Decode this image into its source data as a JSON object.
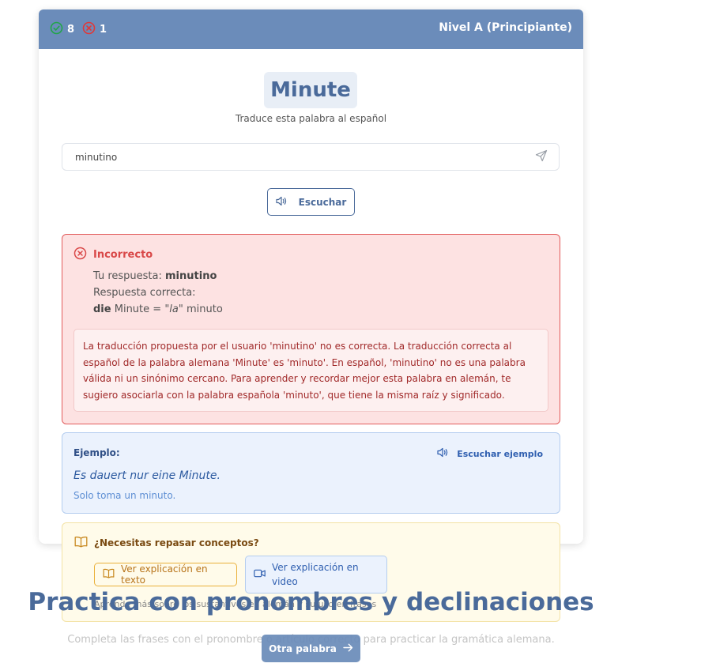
{
  "header": {
    "correct_count": "8",
    "incorrect_count": "1",
    "level": "Nivel A (Principiante)"
  },
  "word": {
    "german": "Minute",
    "instruction": "Traduce esta palabra al español"
  },
  "answer_input": {
    "value": "minutino"
  },
  "listen_button": {
    "label": "Escuchar"
  },
  "feedback": {
    "title": "Incorrecto",
    "your_answer_label": "Tu respuesta:",
    "your_answer": "minutino",
    "correct_label": "Respuesta correcta:",
    "article": "die",
    "noun": "Minute",
    "equals": "=",
    "spanish_article": "\"la\"",
    "translation": "minuto",
    "explanation": "La traducción propuesta por el usuario 'minutino' no es correcta. La traducción correcta al español de la palabra alemana 'Minute' es 'minuto'. En español, 'minutino' no es una palabra válida ni un sinónimo cercano. Para aprender y recordar mejor esta palabra en alemán, te sugiero asociarla con la palabra española 'minuto', que tiene la misma raíz y significado."
  },
  "example": {
    "label": "Ejemplo:",
    "listen_label": "Escuchar ejemplo",
    "sentence": "Es dauert nur eine Minute.",
    "translation": "Solo toma un minuto."
  },
  "concepts": {
    "title": "¿Necesitas repasar conceptos?",
    "text_button": "Ver explicación en texto",
    "video_button": "Ver explicación en video",
    "note": "Aprende más sobre los sustantivos en alemán y su uso en frases"
  },
  "practice": {
    "heading": "Practica con pronombres y declinaciones",
    "description": "Completa las frases con el pronombre o artículo correcto para practicar la gramática alemana."
  },
  "next_button": {
    "label": "Otra palabra"
  },
  "colors": {
    "header": "#6b8cba",
    "primary": "#4a6a9a",
    "error": "#d94848",
    "correct_icon": "#22a54a"
  }
}
